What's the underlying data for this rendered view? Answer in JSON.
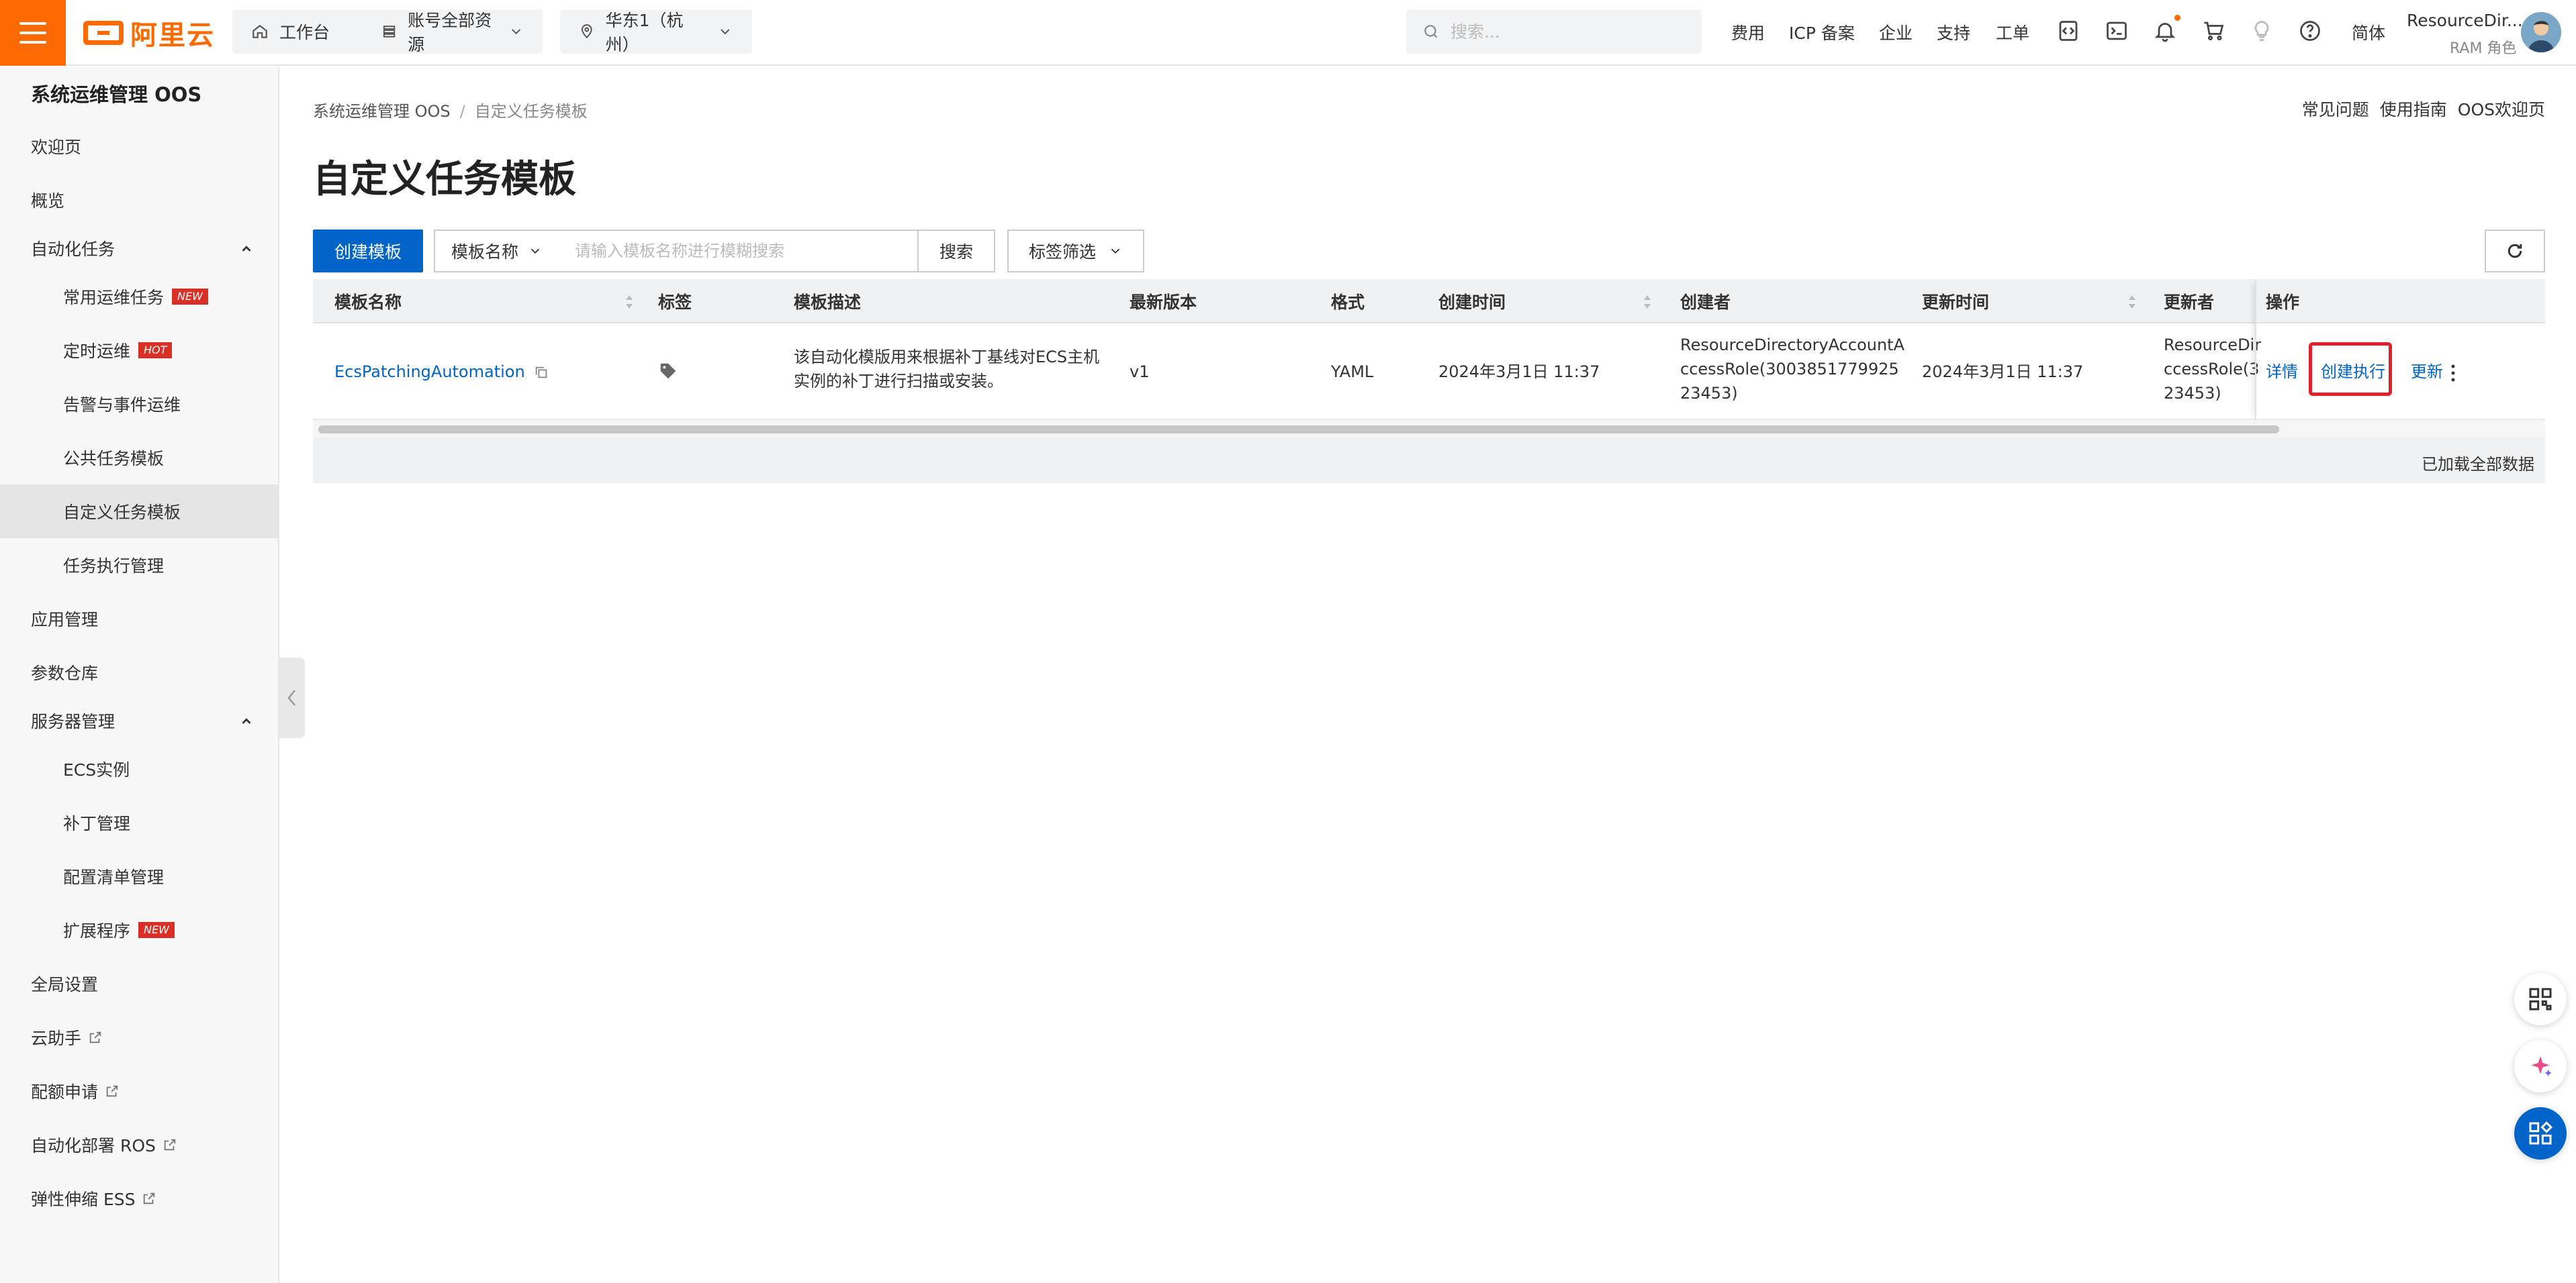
{
  "topbar": {
    "logo_text": "阿里云",
    "workbench": "工作台",
    "resources": "账号全部资源",
    "region": "华东1（杭州）",
    "search_placeholder": "搜索...",
    "links": [
      "费用",
      "ICP 备案",
      "企业",
      "支持",
      "工单"
    ],
    "lang": "简体",
    "user_name": "ResourceDir...",
    "user_role": "RAM 角色",
    "brand_color": "#ff6a00"
  },
  "sidebar": {
    "title": "系统运维管理 OOS",
    "items": [
      {
        "label": "欢迎页"
      },
      {
        "label": "概览"
      },
      {
        "label": "自动化任务"
      },
      {
        "label": "常用运维任务",
        "badge": "NEW"
      },
      {
        "label": "定时运维",
        "badge": "HOT"
      },
      {
        "label": "告警与事件运维"
      },
      {
        "label": "公共任务模板"
      },
      {
        "label": "自定义任务模板"
      },
      {
        "label": "任务执行管理"
      },
      {
        "label": "应用管理"
      },
      {
        "label": "参数仓库"
      },
      {
        "label": "服务器管理"
      },
      {
        "label": "ECS实例"
      },
      {
        "label": "补丁管理"
      },
      {
        "label": "配置清单管理"
      },
      {
        "label": "扩展程序",
        "badge": "NEW"
      },
      {
        "label": "全局设置"
      },
      {
        "label": "云助手"
      },
      {
        "label": "配额申请"
      },
      {
        "label": "自动化部署 ROS"
      },
      {
        "label": "弹性伸缩 ESS"
      }
    ]
  },
  "breadcrumb": {
    "root": "系统运维管理 OOS",
    "current": "自定义任务模板"
  },
  "help_links": [
    "常见问题",
    "使用指南",
    "OOS欢迎页"
  ],
  "page_title": "自定义任务模板",
  "toolbar": {
    "create_label": "创建模板",
    "filter_field": "模板名称",
    "filter_placeholder": "请输入模板名称进行模糊搜索",
    "search_label": "搜索",
    "tag_filter_label": "标签筛选"
  },
  "table": {
    "columns": [
      "模板名称",
      "标签",
      "模板描述",
      "最新版本",
      "格式",
      "创建时间",
      "创建者",
      "更新时间",
      "更新者",
      "操作"
    ],
    "rows": [
      {
        "name": "EcsPatchingAutomation",
        "description_line1": "该自动化模版用来根据补丁基线对ECS主机",
        "description_line2": "实例的补丁进行扫描或安装。",
        "version": "v1",
        "format": "YAML",
        "created_at": "2024年3月1日 11:37",
        "creator_line1": "ResourceDirectoryAccountA",
        "creator_line2": "ccessRole(3003851779925",
        "creator_line3": "23453)",
        "updated_at": "2024年3月1日 11:37",
        "updater_line1": "ResourceDir",
        "updater_line2": "ccessRole(3",
        "updater_line3": "23453)",
        "actions": {
          "detail": "详情",
          "execute": "创建执行",
          "update": "更新"
        }
      }
    ],
    "footer": "已加载全部数据"
  },
  "colors": {
    "primary": "#0064c8",
    "highlight": "#e0202a",
    "badge": "#d93026"
  }
}
